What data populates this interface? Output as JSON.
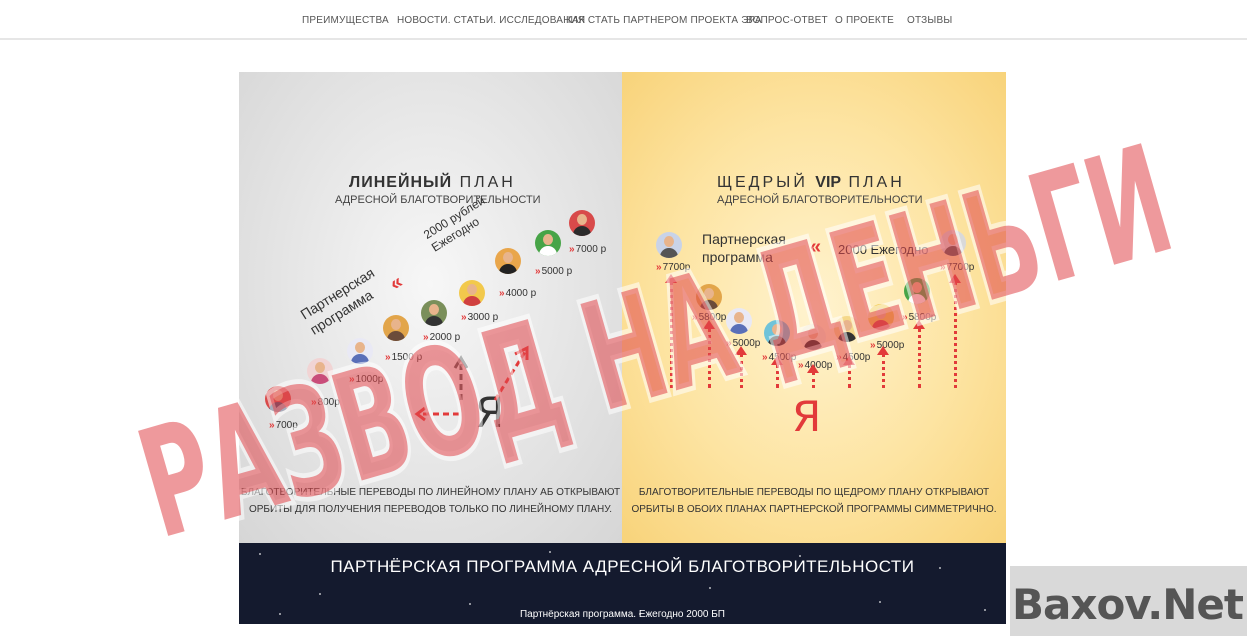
{
  "nav": {
    "items": [
      {
        "label": "ПРЕИМУЩЕСТВА"
      },
      {
        "label": "НОВОСТИ. СТАТЬИ. ИССЛЕДОВАНИЯ"
      },
      {
        "label": "КАК СТАТЬ ПАРТНЕРОМ ПРОЕКТА ЭРА"
      },
      {
        "label": "ВОПРОС-ОТВЕТ"
      },
      {
        "label": "О ПРОЕКТЕ"
      },
      {
        "label": "ОТЗЫВЫ"
      }
    ]
  },
  "left_plan": {
    "title_bold": "ЛИНЕЙНЫЙ",
    "title_rest": "ПЛАН",
    "subtitle": "АДРЕСНОЙ БЛАГОТВОРИТЕЛЬНОСТИ",
    "program_label": "Партнерская программа",
    "yearly_amount": "2000 рублей",
    "yearly_label": "Ежегодно",
    "amounts": [
      "700р",
      "800р",
      "1000р",
      "1500 р",
      "2000 р",
      "3000 р",
      "4000 р",
      "5000 р",
      "7000 р"
    ],
    "ya": "Я",
    "note_line1": "БЛАГОТВОРИТЕЛЬНЫЕ ПЕРЕВОДЫ ПО ЛИНЕЙНОМУ ПЛАНУ АБ ОТКРЫВАЮТ",
    "note_line2": "ОРБИТЫ ДЛЯ ПОЛУЧЕНИЯ ПЕРЕВОДОВ ТОЛЬКО ПО ЛИНЕЙНОМУ ПЛАНУ."
  },
  "right_plan": {
    "title_prefix": "ЩЕДРЫЙ",
    "title_vip": "VIP",
    "title_rest": "ПЛАН",
    "subtitle": "АДРЕСНОЙ БЛАГОТВОРИТЕЛЬНОСТИ",
    "program_label_1": "Партнерская",
    "program_label_2": "программа",
    "yearly_text": "2000 Ежегодно",
    "amounts": [
      "7700р",
      "5800р",
      "5000р",
      "4500р",
      "4000р",
      "4500р",
      "5000р",
      "5800р",
      "7700р"
    ],
    "ya": "Я",
    "note_line1": "БЛАГОТВОРИТЕЛЬНЫЕ ПЕРЕВОДЫ ПО ЩЕДРОМУ ПЛАНУ ОТКРЫВАЮТ",
    "note_line2": "ОРБИТЫ В ОБОИХ ПЛАНАХ ПАРТНЕРСКОЙ ПРОГРАММЫ СИММЕТРИЧНО."
  },
  "bottom": {
    "title": "ПАРТНЁРСКАЯ ПРОГРАММА АДРЕСНОЙ БЛАГОТВОРИТЕЛЬНОСТИ",
    "caption": "Партнёрская программа. Ежегодно 2000 БП"
  },
  "stamp": {
    "text": "РАЗВОД НА ДЕНЬГИ",
    "color": "#e0454a"
  },
  "watermark": {
    "text": "Baxov.Net"
  },
  "colors": {
    "accent_red": "#e23a3a",
    "left_bg": "#e3e3e3",
    "right_bg": "#fde4a2",
    "bottom_bg": "#141a2e"
  }
}
